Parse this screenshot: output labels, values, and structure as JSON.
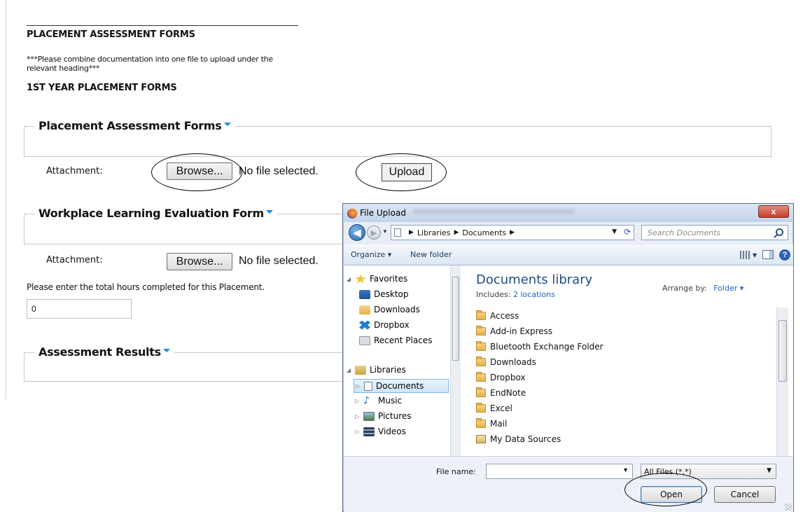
{
  "page": {
    "heading_main": "PLACEMENT ASSESSMENT FORMS",
    "note": "***Please combine documentation into one file to upload under the relevant heading***",
    "heading_year": "1ST YEAR PLACEMENT FORMS",
    "sections": [
      {
        "legend": "Placement Assessment Forms"
      },
      {
        "legend": "Workplace Learning Evaluation Form"
      },
      {
        "legend": "Assessment Results"
      }
    ],
    "attachments": [
      {
        "label": "Attachment:",
        "browse": "Browse...",
        "status": "No file selected.",
        "upload": "Upload"
      },
      {
        "label": "Attachment:",
        "browse": "Browse...",
        "status": "No file selected."
      }
    ],
    "hours_label": "Please enter the total hours completed for this Placement.",
    "hours_value": "0",
    "accent_color": "#1e88d6"
  },
  "dialog": {
    "title": "File Upload",
    "close_label": "x",
    "breadcrumb": [
      "Libraries",
      "Documents"
    ],
    "search_placeholder": "Search Documents",
    "toolbar": {
      "organize": "Organize ▾",
      "new_folder": "New folder"
    },
    "nav": {
      "favorites": "Favorites",
      "favorite_items": [
        "Desktop",
        "Downloads",
        "Dropbox",
        "Recent Places"
      ],
      "libraries": "Libraries",
      "library_items": [
        "Documents",
        "Music",
        "Pictures",
        "Videos"
      ]
    },
    "library_title": "Documents library",
    "includes_prefix": "Includes:",
    "includes_link": "2 locations",
    "arrange_label": "Arrange by:",
    "arrange_value": "Folder ▾",
    "files": [
      "Access",
      "Add-in Express",
      "Bluetooth Exchange Folder",
      "Downloads",
      "Dropbox",
      "EndNote",
      "Excel",
      "Mail",
      "My Data Sources"
    ],
    "file_name_label": "File name:",
    "file_name_value": "",
    "filter_value": "All Files (*.*)",
    "open_label": "Open",
    "cancel_label": "Cancel"
  }
}
